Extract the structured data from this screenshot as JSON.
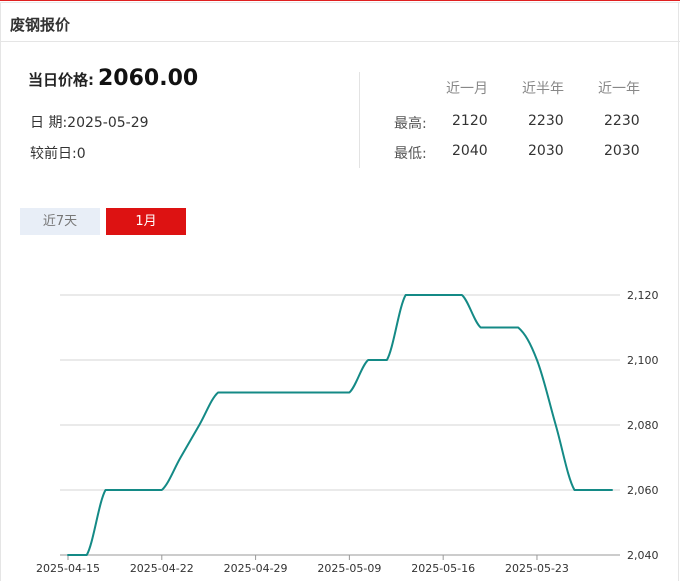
{
  "header": {
    "title": "废钢报价"
  },
  "price": {
    "label": "当日价格:",
    "value": "2060.00"
  },
  "date": {
    "label": "日 期:",
    "value": "2025-05-29"
  },
  "diff": {
    "label": "较前日:",
    "value": "0"
  },
  "stats": {
    "columns": [
      "近一月",
      "近半年",
      "近一年"
    ],
    "high": {
      "label": "最高:",
      "values": [
        "2120",
        "2230",
        "2230"
      ]
    },
    "low": {
      "label": "最低:",
      "values": [
        "2040",
        "2030",
        "2030"
      ]
    }
  },
  "tabs": [
    {
      "label": "近7天",
      "active": false
    },
    {
      "label": "1月",
      "active": true
    }
  ],
  "colors": {
    "line": "#148a86",
    "accent": "#dd1212",
    "tab_inactive": "#e8eef7"
  },
  "chart_data": {
    "type": "line",
    "y_axis_position": "right",
    "grid": true,
    "ylim": [
      2040,
      2120
    ],
    "yticks": [
      "2,040",
      "2,060",
      "2,080",
      "2,100",
      "2,120"
    ],
    "xticks": [
      "2025-04-15",
      "2025-04-22",
      "2025-04-29",
      "2025-05-09",
      "2025-05-16",
      "2025-05-23"
    ],
    "series": [
      {
        "points": [
          [
            "2025-04-15",
            2040
          ],
          [
            "2025-04-16",
            2040
          ],
          [
            "2025-04-17",
            2060
          ],
          [
            "2025-04-18",
            2060
          ],
          [
            "2025-04-21",
            2060
          ],
          [
            "2025-04-22",
            2060
          ],
          [
            "2025-04-23",
            2070
          ],
          [
            "2025-04-24",
            2080
          ],
          [
            "2025-04-25",
            2090
          ],
          [
            "2025-04-28",
            2090
          ],
          [
            "2025-04-29",
            2090
          ],
          [
            "2025-04-30",
            2090
          ],
          [
            "2025-05-06",
            2090
          ],
          [
            "2025-05-07",
            2090
          ],
          [
            "2025-05-08",
            2090
          ],
          [
            "2025-05-09",
            2090
          ],
          [
            "2025-05-12",
            2100
          ],
          [
            "2025-05-13",
            2100
          ],
          [
            "2025-05-14",
            2120
          ],
          [
            "2025-05-15",
            2120
          ],
          [
            "2025-05-16",
            2120
          ],
          [
            "2025-05-19",
            2120
          ],
          [
            "2025-05-20",
            2110
          ],
          [
            "2025-05-21",
            2110
          ],
          [
            "2025-05-22",
            2110
          ],
          [
            "2025-05-23",
            2100
          ],
          [
            "2025-05-26",
            2080
          ],
          [
            "2025-05-27",
            2060
          ],
          [
            "2025-05-28",
            2060
          ],
          [
            "2025-05-29",
            2060
          ]
        ]
      }
    ]
  }
}
